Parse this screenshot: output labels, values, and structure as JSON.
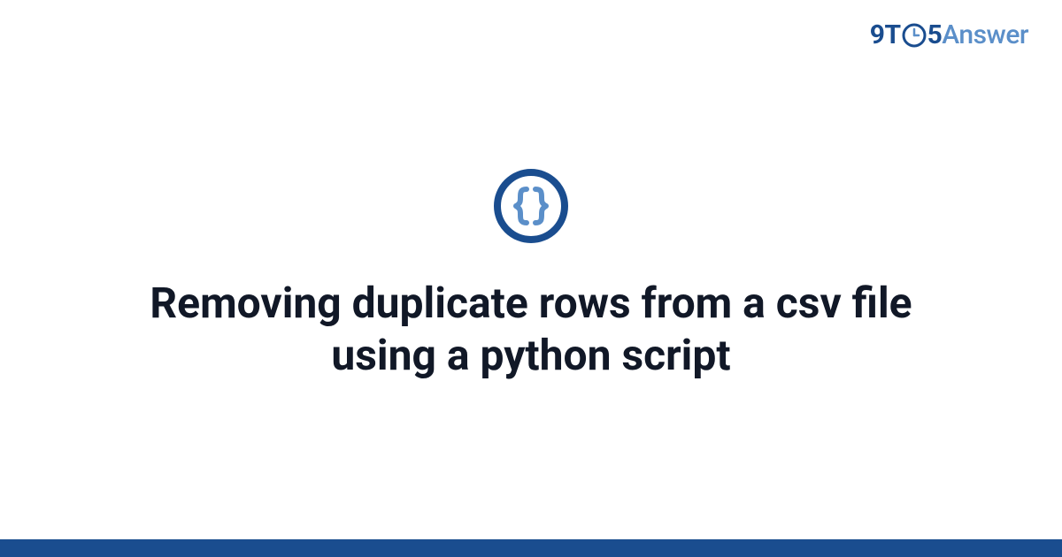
{
  "brand": {
    "part1": "9T",
    "part2": "5",
    "part3": "Answer",
    "clock_icon_name": "clock-icon"
  },
  "badge": {
    "icon_name": "braces-icon",
    "ring_color": "#1a4d8f",
    "brace_color": "#5b8fc9"
  },
  "main": {
    "title": "Removing duplicate rows from a csv file using a python script"
  },
  "colors": {
    "accent_dark": "#1a4d8f",
    "accent_light": "#5b8fc9",
    "text": "#111827",
    "bg": "#ffffff"
  }
}
